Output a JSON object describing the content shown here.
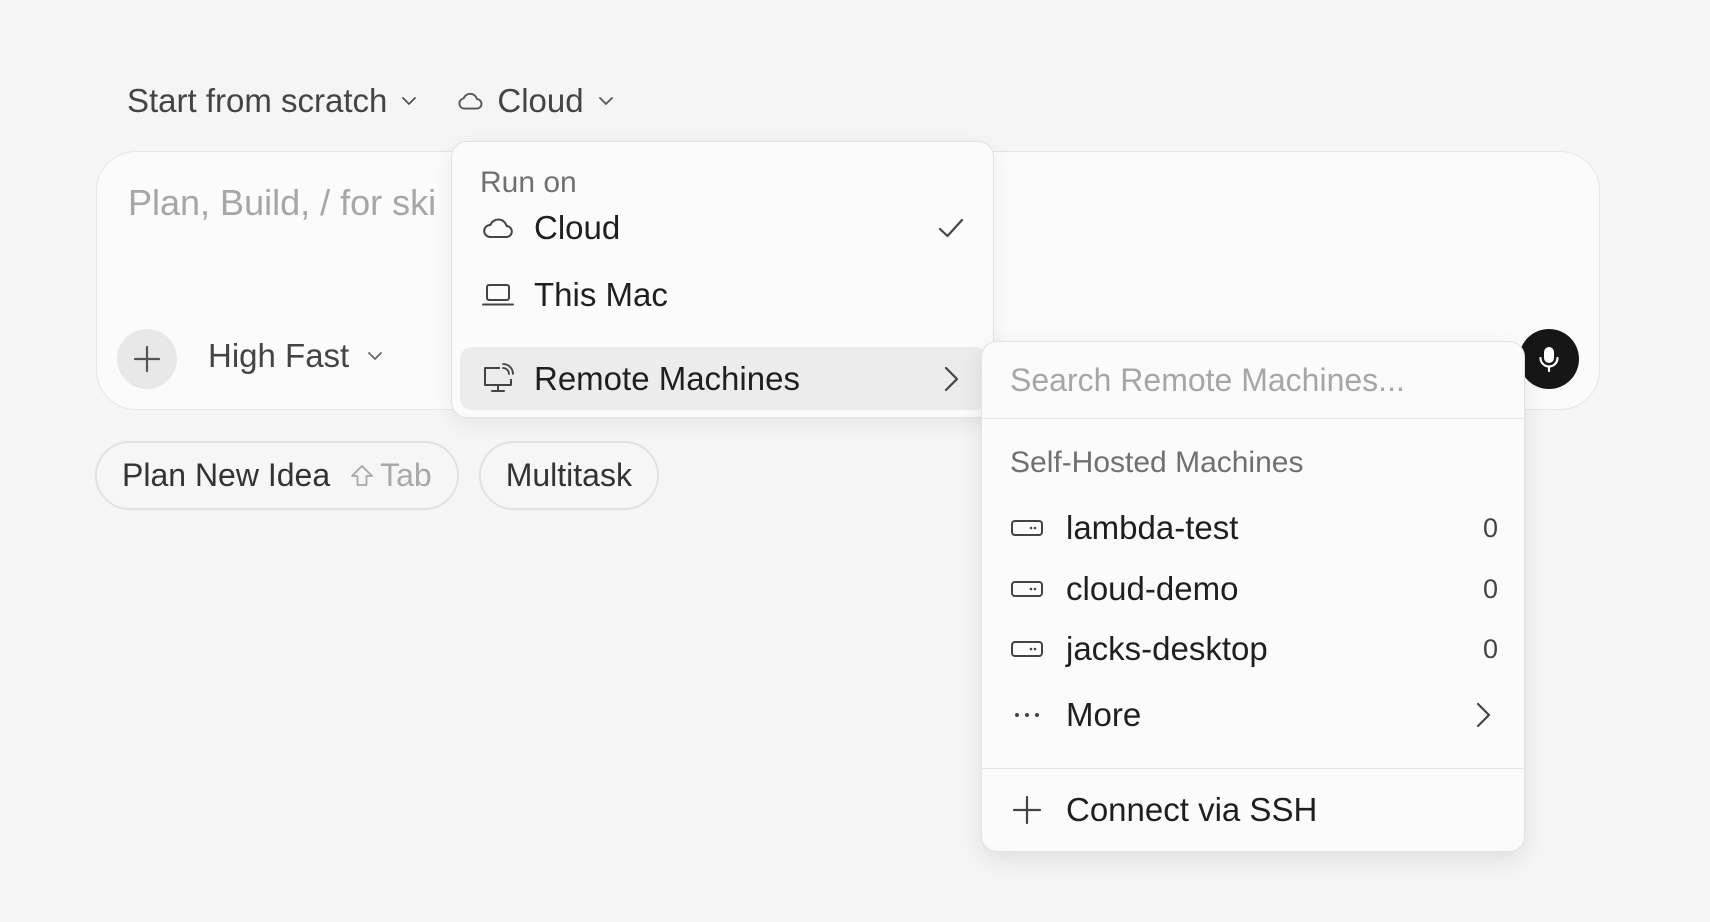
{
  "toolbar": {
    "template_label": "Start from scratch",
    "environment_label": "Cloud"
  },
  "composer": {
    "placeholder": "Plan, Build, / for ski",
    "model_label": "High Fast"
  },
  "chips": {
    "plan_label": "Plan New Idea",
    "plan_shortcut": "Tab",
    "multitask_label": "Multitask"
  },
  "run_on_menu": {
    "header": "Run on",
    "items": [
      {
        "label": "Cloud",
        "icon": "cloud-icon",
        "selected": true
      },
      {
        "label": "This Mac",
        "icon": "laptop-icon",
        "selected": false
      },
      {
        "label": "Remote Machines",
        "icon": "remote-monitor-icon",
        "has_submenu": true
      }
    ]
  },
  "remote_menu": {
    "search_placeholder": "Search Remote Machines...",
    "section_header": "Self-Hosted Machines",
    "machines": [
      {
        "name": "lambda-test",
        "count": "0"
      },
      {
        "name": "cloud-demo",
        "count": "0"
      },
      {
        "name": "jacks-desktop",
        "count": "0"
      }
    ],
    "more_label": "More",
    "connect_label": "Connect via SSH"
  },
  "colors": {
    "background": "#f5f5f5",
    "surface": "#fbfbfb",
    "active_row": "#ececec",
    "mic_button": "#161616"
  }
}
